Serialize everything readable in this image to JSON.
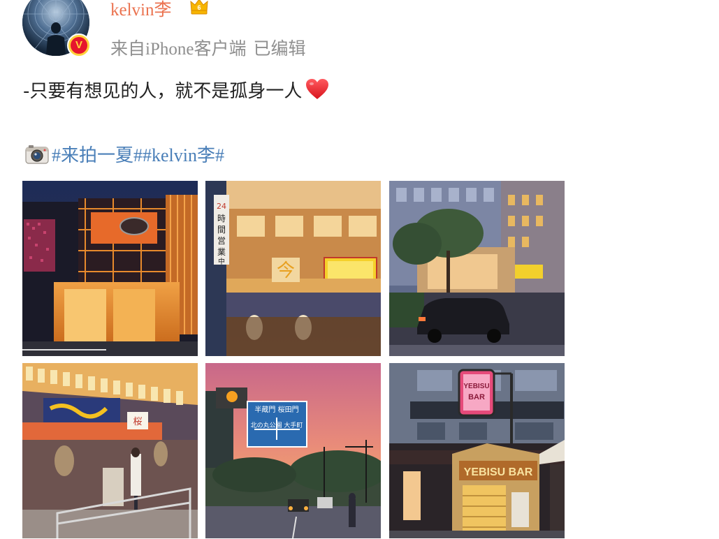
{
  "post": {
    "username": "kelvin李",
    "source": "来自iPhone客户端",
    "edited": "已编辑",
    "text": "-只要有想见的人，就不是孤身一人",
    "tags": [
      "#来拍一夏#",
      "#kelvin李#"
    ]
  },
  "badges": {
    "verified": "V",
    "vip_level": "6"
  },
  "icons": {
    "verified": "verified-badge-icon",
    "vip": "vip-crown-icon",
    "heart": "heart-emoji-icon",
    "camera": "camera-emoji-icon"
  },
  "photos": [
    {
      "id": "photo-1",
      "desc": "ginza-building-night"
    },
    {
      "id": "photo-2",
      "desc": "izakaya-24h-storefront"
    },
    {
      "id": "photo-3",
      "desc": "street-car-evening"
    },
    {
      "id": "photo-4",
      "desc": "izakaya-lantern-alley"
    },
    {
      "id": "photo-5",
      "desc": "sunset-street-sign"
    },
    {
      "id": "photo-6",
      "desc": "yebisu-bar-sign"
    }
  ],
  "photo_text": {
    "p2_sign": "24時間営業中",
    "p6_sign_small": "YEBISU BAR",
    "p6_sign_large": "YEBISU BAR",
    "p5_sign_top": "半蔵門 桜田門",
    "p5_sign_mid": "北の丸公園 大手町"
  },
  "colors": {
    "username": "#eb7350",
    "link": "#4a7fb8",
    "meta": "#9a9a9a",
    "text": "#222222"
  }
}
